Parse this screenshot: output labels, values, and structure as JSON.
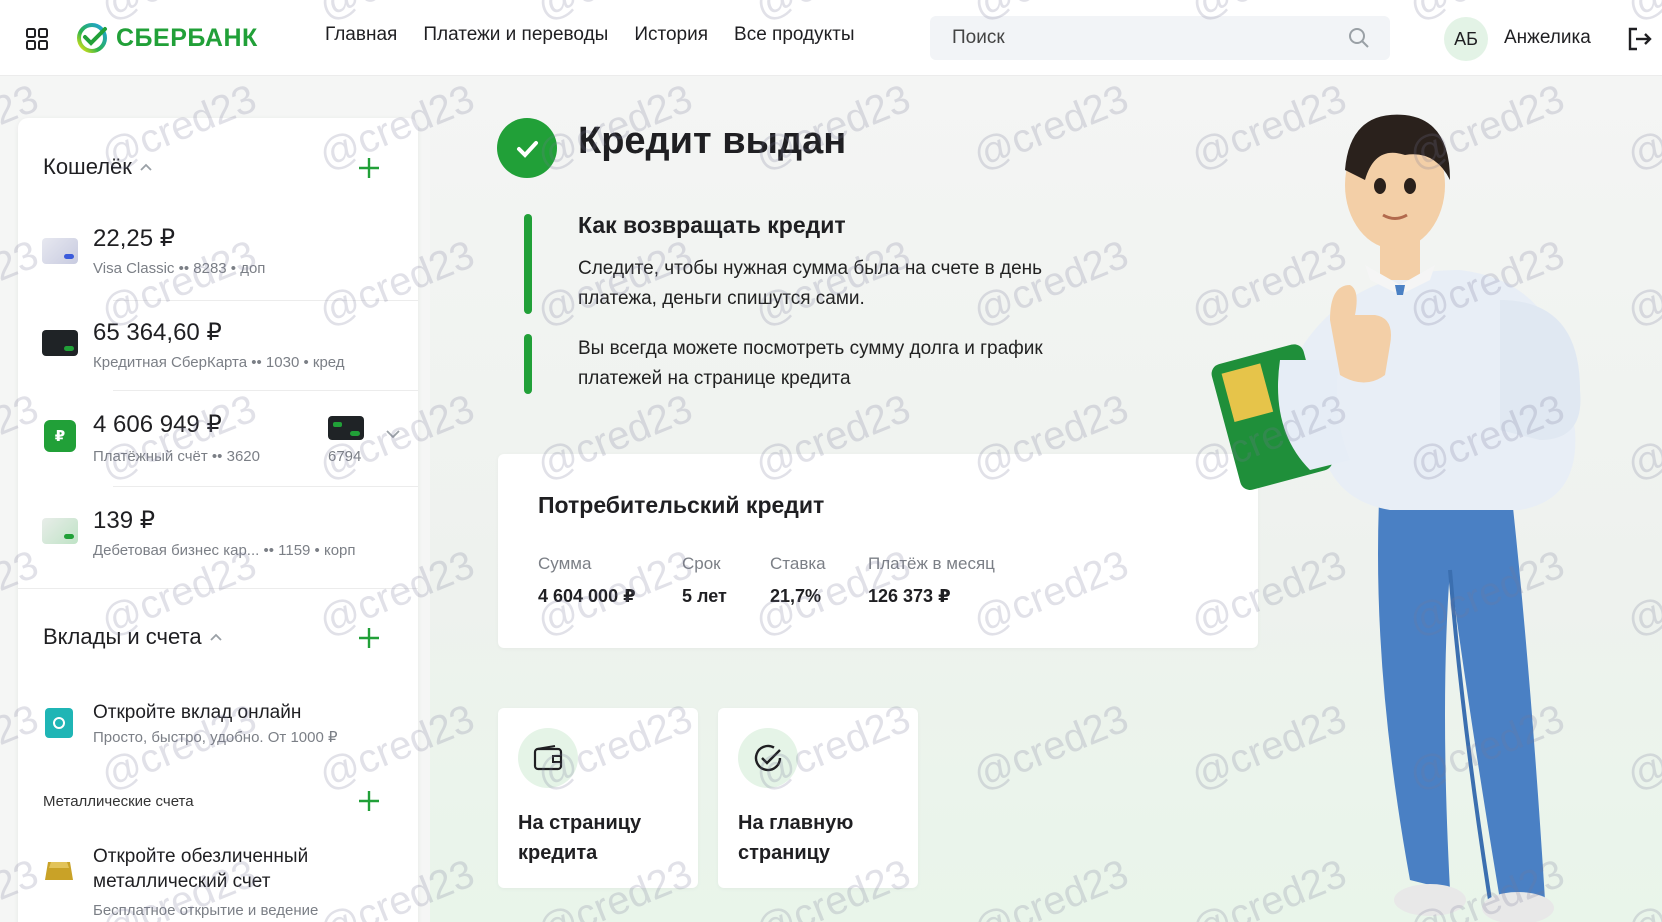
{
  "header": {
    "logo_text": "СБЕРБАНК",
    "nav": [
      "Главная",
      "Платежи и переводы",
      "История",
      "Все продукты"
    ],
    "search_placeholder": "Поиск",
    "avatar_initials": "АБ",
    "username": "Анжелика"
  },
  "sidebar": {
    "wallet": {
      "title": "Кошелёк",
      "accounts": [
        {
          "amount": "22,25 ₽",
          "sub": "Visa Classic •• 8283 • доп",
          "icon": "card-grey-icon"
        },
        {
          "amount": "65 364,60 ₽",
          "sub": "Кредитная СберКарта •• 1030 • кред",
          "icon": "card-black-icon"
        },
        {
          "amount": "4 606 949 ₽",
          "sub": "Платёжный счёт •• 3620",
          "icon": "ruble-account-icon",
          "linked_card": "6794"
        },
        {
          "amount": "139 ₽",
          "sub": "Дебетовая бизнес кар...  •• 1159 • корп",
          "icon": "card-business-icon"
        }
      ]
    },
    "deposits": {
      "title": "Вклады и счета",
      "promo_title": "Откройте вклад онлайн",
      "promo_sub": "Просто, быстро, удобно. От 1000 ₽",
      "metal_label": "Металлические счета",
      "metal_title": "Откройте обезличенный металлический счет",
      "metal_sub": "Бесплатное открытие и ведение"
    }
  },
  "main": {
    "title": "Кредит выдан",
    "step_title": "Как возвращать кредит",
    "step1": "Следите, чтобы нужная сумма была на счете в день платежа, деньги спишутся сами.",
    "step2": "Вы всегда можете посмотреть сумму долга и график платежей на странице кредита",
    "credit": {
      "title": "Потребительский кредит",
      "sum_label": "Сумма",
      "sum_value": "4 604 000 ₽",
      "term_label": "Срок",
      "term_value": "5 лет",
      "rate_label": "Ставка",
      "rate_value": "21,7%",
      "payment_label": "Платёж в месяц",
      "payment_value": "126 373 ₽"
    },
    "tiles": [
      {
        "label": "На страницу кредита",
        "icon": "wallet-icon"
      },
      {
        "label": "На главную страницу",
        "icon": "check-circle-icon"
      }
    ]
  },
  "watermark": "@cred23",
  "colors": {
    "brand": "#21a038",
    "accent_bg": "#e5f4e7"
  }
}
